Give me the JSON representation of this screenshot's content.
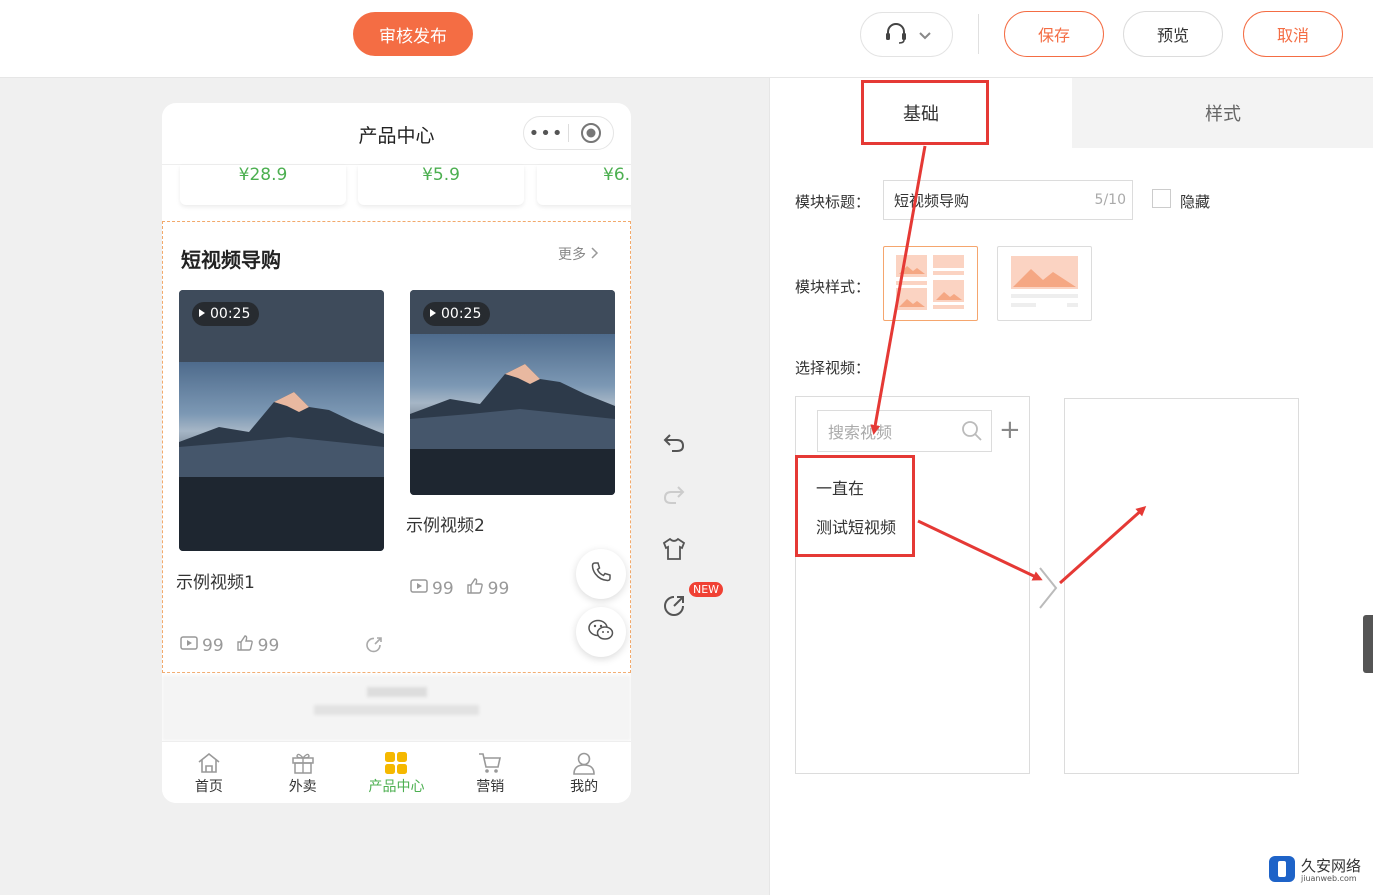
{
  "toolbar": {
    "publish_label": "审核发布",
    "save_label": "保存",
    "preview_label": "预览",
    "cancel_label": "取消"
  },
  "phone": {
    "title": "产品中心",
    "capsule_dots": "•••",
    "prices": [
      "¥28.9",
      "¥5.9",
      "¥6."
    ],
    "module": {
      "title": "短视频导购",
      "more_label": "更多",
      "videos": [
        {
          "name": "示例视频1",
          "duration": "00:25",
          "views": "99",
          "likes": "99"
        },
        {
          "name": "示例视频2",
          "duration": "00:25",
          "views": "99",
          "likes": "99"
        }
      ]
    },
    "tabs": [
      {
        "label": "首页",
        "icon": "home-icon"
      },
      {
        "label": "外卖",
        "icon": "gift-icon"
      },
      {
        "label": "产品中心",
        "icon": "grid-icon",
        "active": true
      },
      {
        "label": "营销",
        "icon": "cart-icon"
      },
      {
        "label": "我的",
        "icon": "user-icon"
      }
    ]
  },
  "tools": {
    "new_badge": "NEW"
  },
  "panel": {
    "tab_basic": "基础",
    "tab_style": "样式",
    "module_title_label": "模块标题：",
    "module_title_value": "短视频导购",
    "module_title_count": "5/10",
    "hide_label": "隐藏",
    "module_style_label": "模块样式：",
    "select_video_label": "选择视频：",
    "search_placeholder": "搜索视频",
    "list_items": [
      "一直在",
      "测试短视频"
    ]
  },
  "watermark": {
    "name": "久安网络",
    "url": "jiuanweb.com"
  },
  "colors": {
    "accent": "#f46d44",
    "green": "#4caf50",
    "annotation_red": "#e53935"
  }
}
